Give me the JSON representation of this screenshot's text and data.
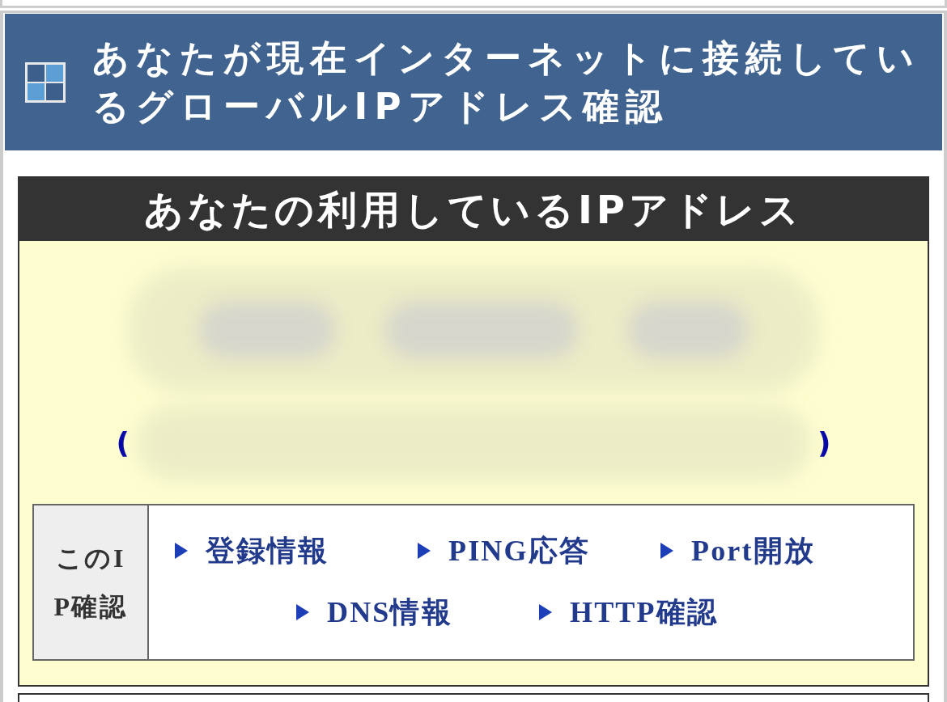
{
  "section_header": {
    "title": "あなたが現在インターネットに接続しているグローバルIPアドレス確認"
  },
  "ip_panel": {
    "title": "あなたの利用しているIPアドレス",
    "host_open": "(",
    "host_close": ")"
  },
  "check_table": {
    "label": "このIP確認",
    "links": [
      {
        "label": "登録情報"
      },
      {
        "label": "PING応答"
      },
      {
        "label": "Port開放"
      },
      {
        "label": "DNS情報"
      },
      {
        "label": "HTTP確認"
      }
    ]
  }
}
